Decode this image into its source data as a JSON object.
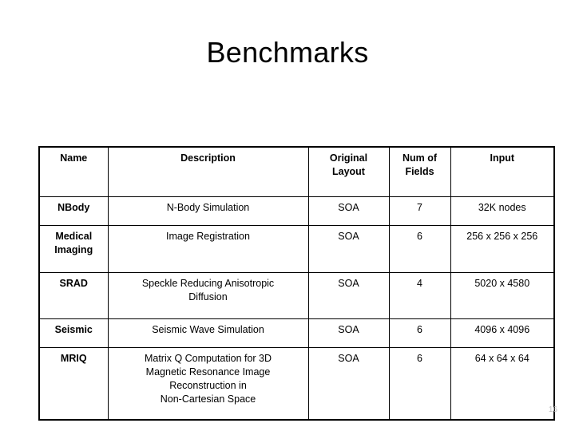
{
  "slide": {
    "title": "Benchmarks",
    "page_number": "16"
  },
  "table": {
    "headers": {
      "name": "Name",
      "description": "Description",
      "original_layout": "Original\nLayout",
      "num_of_fields": "Num of\nFields",
      "input": "Input"
    },
    "rows": [
      {
        "name": "NBody",
        "description": "N-Body Simulation",
        "original_layout": "SOA",
        "num_of_fields": "7",
        "input": "32K nodes"
      },
      {
        "name": "Medical\nImaging",
        "description": "Image Registration",
        "original_layout": "SOA",
        "num_of_fields": "6",
        "input": "256 x 256 x 256"
      },
      {
        "name": "SRAD",
        "description": "Speckle Reducing Anisotropic\nDiffusion",
        "original_layout": "SOA",
        "num_of_fields": "4",
        "input": "5020 x 4580"
      },
      {
        "name": "Seismic",
        "description": "Seismic Wave Simulation",
        "original_layout": "SOA",
        "num_of_fields": "6",
        "input": "4096 x 4096"
      },
      {
        "name": "MRIQ",
        "description": "Matrix Q Computation for 3D\nMagnetic Resonance Image\nReconstruction in\nNon-Cartesian Space",
        "original_layout": "SOA",
        "num_of_fields": "6",
        "input": "64 x 64 x 64"
      }
    ]
  },
  "colors": {
    "background": "#ffffff",
    "text": "#000000",
    "border": "#000000",
    "page_number": "#bfbfbf"
  }
}
